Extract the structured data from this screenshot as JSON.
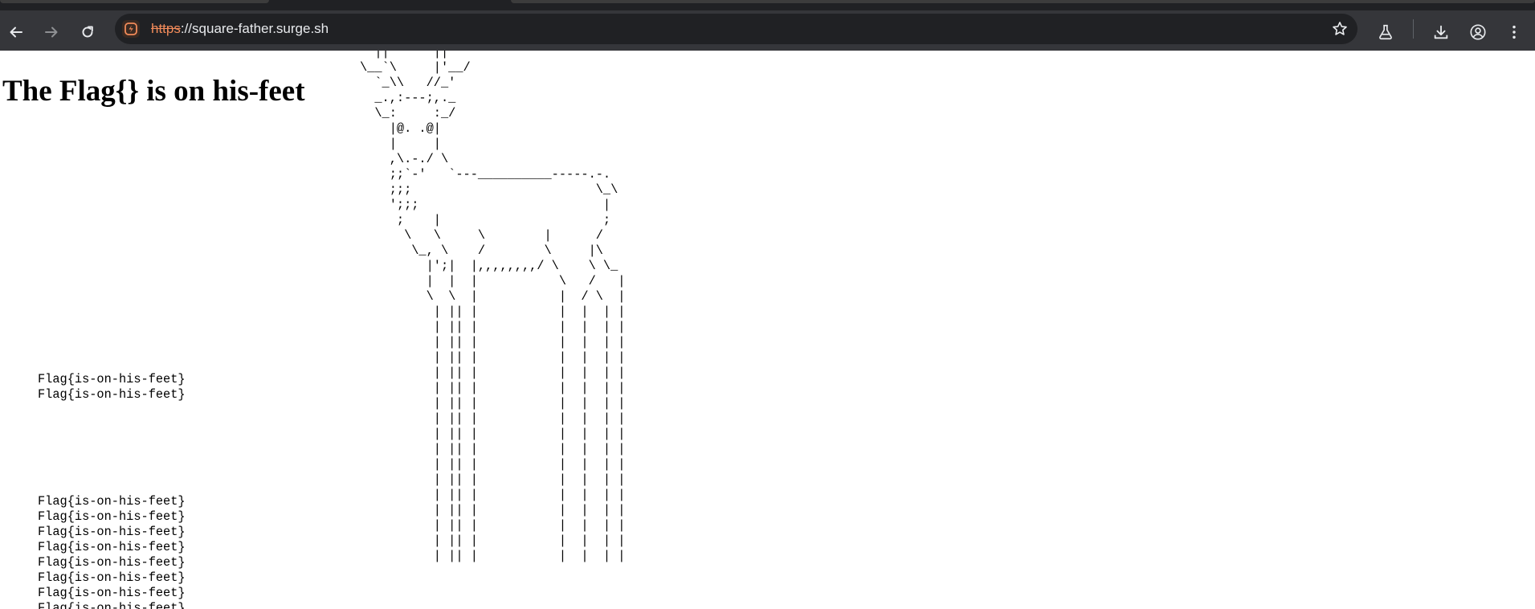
{
  "browser": {
    "back_icon": "arrow-left-icon",
    "forward_icon": "arrow-right-icon",
    "reload_icon": "reload-icon",
    "site_icon": "site-info-icon",
    "url_scheme": "https",
    "url_rest": "://square-father.surge.sh",
    "bookmark_icon": "star-icon",
    "labs_icon": "flask-icon",
    "download_icon": "download-icon",
    "profile_icon": "profile-icon",
    "menu_icon": "kebab-menu-icon",
    "accent_color": "#f28b5a"
  },
  "page": {
    "title": "The Flag{} is on his-feet",
    "ascii_art": "  ||      ||\n\\__`\\     |'__/\n  `_\\\\   //_'\n  _.,:---;,._\n  \\_:     :_/\n    |@. .@|\n    |     |\n    ,\\.-./ \\\n    ;;`-'   `---__________-----.-.\n    ;;;                         \\_\\\n    ';;;                         |\n     ;    |                      ;\n      \\   \\     \\        |      /\n       \\_, \\    /        \\     |\\\n         |';|  |,,,,,,,,/ \\    \\ \\_\n         |  |  |           \\   /   |\n         \\  \\  |           |  / \\  |\n          | || |           |  |  | |\n          | || |           |  |  | |\n          | || |           |  |  | |\n          | || |           |  |  | |\n          | || |           |  |  | |\n          | || |           |  |  | |\n          | || |           |  |  | |\n          | || |           |  |  | |\n          | || |           |  |  | |\n          | || |           |  |  | |\n          | || |           |  |  | |\n          | || |           |  |  | |\n          | || |           |  |  | |\n          | || |           |  |  | |\n          | || |           |  |  | |\n          | || |           |  |  | |\n          | || |           |  |  | |",
    "flags_group1": [
      "Flag{is-on-his-feet}",
      "Flag{is-on-his-feet}"
    ],
    "flags_group2": [
      "Flag{is-on-his-feet}",
      "Flag{is-on-his-feet}",
      "Flag{is-on-his-feet}",
      "Flag{is-on-his-feet}",
      "Flag{is-on-his-feet}",
      "Flag{is-on-his-feet}",
      "Flag{is-on-his-feet}",
      "Flag{is-on-his-feet}"
    ]
  }
}
